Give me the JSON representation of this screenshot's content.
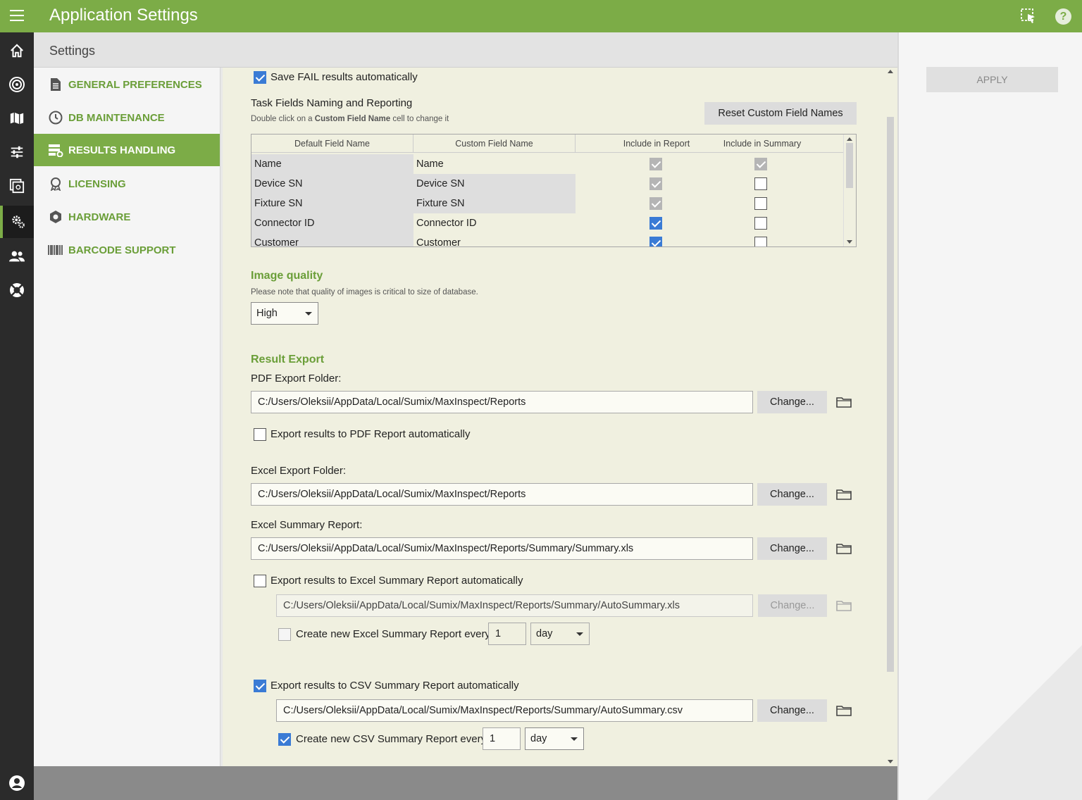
{
  "app": {
    "title": "Application Settings"
  },
  "settings_header": "Settings",
  "nav": [
    {
      "label": "GENERAL PREFERENCES",
      "icon": "document-icon"
    },
    {
      "label": "DB MAINTENANCE",
      "icon": "clock-icon"
    },
    {
      "label": "RESULTS HANDLING",
      "icon": "server-gear-icon",
      "active": true
    },
    {
      "label": "LICENSING",
      "icon": "award-icon"
    },
    {
      "label": "HARDWARE",
      "icon": "hexagon-icon"
    },
    {
      "label": "BARCODE SUPPORT",
      "icon": "barcode-icon"
    }
  ],
  "rail": [
    "home-icon",
    "target-icon",
    "map-icon",
    "sliders-icon",
    "gallery-icon",
    "settings-icon",
    "users-icon",
    "lifebuoy-icon",
    "account-icon"
  ],
  "save_fail": {
    "label": "Save FAIL results automatically",
    "checked": true
  },
  "task_fields": {
    "title": "Task Fields Naming and Reporting",
    "hint_prefix": "Double click on a ",
    "hint_bold": "Custom Field Name",
    "hint_suffix": " cell to change it",
    "reset_button": "Reset Custom Field Names",
    "columns": [
      "Default Field Name",
      "Custom Field Name",
      "Include in Report",
      "Include in Summary"
    ],
    "rows": [
      {
        "default": "Name",
        "custom": "Name",
        "report": "disabled",
        "summary": "disabled"
      },
      {
        "default": "Device SN",
        "custom": "Device SN",
        "report": "disabled",
        "summary": "off"
      },
      {
        "default": "Fixture SN",
        "custom": "Fixture SN",
        "report": "disabled",
        "summary": "off"
      },
      {
        "default": "Connector ID",
        "custom": "Connector ID",
        "report": "on",
        "summary": "off"
      },
      {
        "default": "Customer",
        "custom": "Customer",
        "report": "on",
        "summary": "off"
      }
    ]
  },
  "image_quality": {
    "title": "Image quality",
    "note": "Please note  that quality of images is critical to size of database.",
    "value": "High"
  },
  "result_export": {
    "title": "Result Export",
    "pdf_label": "PDF Export Folder:",
    "pdf_path": "C:/Users/Oleksii/AppData/Local/Sumix/MaxInspect/Reports",
    "pdf_auto": "Export results to PDF Report automatically",
    "excel_label": "Excel Export Folder:",
    "excel_path": "C:/Users/Oleksii/AppData/Local/Sumix/MaxInspect/Reports",
    "summary_label": "Excel Summary Report:",
    "summary_path": "C:/Users/Oleksii/AppData/Local/Sumix/MaxInspect/Reports/Summary/Summary.xls",
    "excel_auto": "Export results to Excel Summary Report automatically",
    "excel_auto_path": "C:/Users/Oleksii/AppData/Local/Sumix/MaxInspect/Reports/Summary/AutoSummary.xls",
    "excel_new_every": "Create new Excel Summary Report every",
    "excel_every_num": "1",
    "excel_every_unit": "day",
    "csv_auto": "Export results to CSV Summary Report automatically",
    "csv_path": "C:/Users/Oleksii/AppData/Local/Sumix/MaxInspect/Reports/Summary/AutoSummary.csv",
    "csv_new_every": "Create new CSV Summary Report every",
    "csv_every_num": "1",
    "csv_every_unit": "day",
    "change": "Change..."
  },
  "apply": "APPLY",
  "colors": {
    "accent": "#7cac47",
    "rail": "#2b2b2b",
    "checkbox": "#3a7bd5"
  }
}
